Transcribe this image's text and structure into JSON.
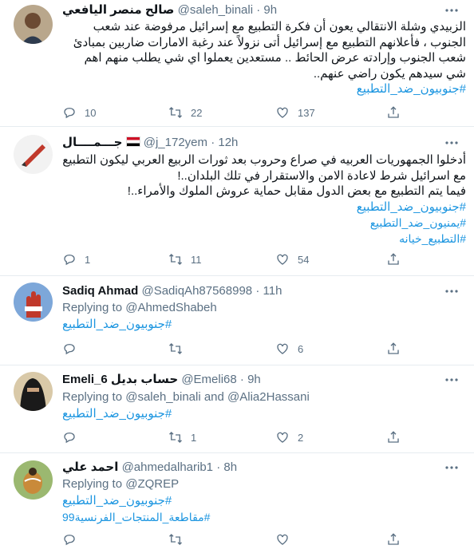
{
  "tweets": [
    {
      "name": "صالح منصر اليافعي",
      "handle": "@saleh_binali",
      "time": "9h",
      "lines": [
        "الزبيدي وشلة الانتقالي يعون أن فكرة التطبيع مع إسرائيل مرفوضة عند شعب",
        "الجنوب ، فأعلانهم التطبيع مع إسرائيل أتى نزولاً عند رغبة الامارات ضاربين بمبادئ",
        "شعب الجنوب وإرادته عرض الحائط .. مستعدين يعملوا اي شي يطلب منهم اهم",
        "شي سيدهم يكون راضي عنهم.."
      ],
      "hashtags": [
        "#جنوبيون_ضد_التطبيع"
      ],
      "replies": "10",
      "retweets": "22",
      "likes": "137"
    },
    {
      "name": "جـــمــــال",
      "flag": "yemen-flag",
      "handle": "@j_172yem",
      "time": "12h",
      "lines": [
        "أدخلوا الجمهوريات العربيه في صراع وحروب بعد ثورات الربيع العربي ليكون التطبيع",
        "مع اسرائيل شرط لاعادة الامن والاستقرار في تلك البلدان..!",
        "فيما يتم التطبيع مع بعض الدول مقابل حماية عروش الملوك والأمراء..!"
      ],
      "hashtags": [
        "#جنوبيون_ضد_التطبيع",
        "#يمنيون_ضد_التطبيع",
        "#التطبيع_خيانه"
      ],
      "replies": "1",
      "retweets": "11",
      "likes": "54"
    },
    {
      "name": "Sadiq Ahmad",
      "handle": "@SadiqAh87568998",
      "time": "11h",
      "replying": "Replying to @AhmedShabeh",
      "hashtags": [
        "#جنوبيون_ضد_التطبيع"
      ],
      "replies": "",
      "retweets": "",
      "likes": "6"
    },
    {
      "name": "Emeli_6 حساب بديل",
      "handle": "@Emeli68",
      "time": "9h",
      "replying": "Replying to @saleh_binali and @Alia2Hassani",
      "hashtags": [
        "#جنوبيون_ضد_التطبيع"
      ],
      "replies": "",
      "retweets": "1",
      "likes": "2"
    },
    {
      "name": "احمد علي",
      "handle": "@ahmedalharib1",
      "time": "8h",
      "replying": "Replying to @ZQREP",
      "hashtags": [
        "#جنوبيون_ضد_التطبيع",
        "#مقاطعة_المنتجات_الفرنسية99"
      ],
      "replies": "",
      "retweets": "",
      "likes": ""
    }
  ],
  "sep": "·",
  "colors": {
    "link": "#1b95e0",
    "muted": "#5b7083",
    "border": "#e6ecf0"
  }
}
